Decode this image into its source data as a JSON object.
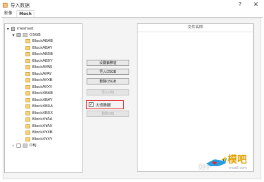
{
  "window": {
    "title": "导入数据",
    "help": "?",
    "close": "×"
  },
  "tabs": [
    {
      "label": "影像"
    },
    {
      "label": "Mesh"
    }
  ],
  "tree": {
    "root": {
      "label": "meshset",
      "expander": "▾"
    },
    "osgb": {
      "label": "OSGB",
      "expander": "▾"
    },
    "blocks": [
      "BlockABAB",
      "BlockABAY",
      "BlockABXB",
      "BlockABXY",
      "BlockAYAB",
      "BlockAYAY",
      "BlockAYXB",
      "BlockAYXY",
      "BlockXBAB",
      "BlockXBAY",
      "BlockXBXA",
      "BlockXBXX",
      "BlockXYAA",
      "BlockXYAX",
      "BlockXYXB",
      "BlockXYXY"
    ],
    "obj": {
      "label": "OBJ",
      "expander": "›"
    }
  },
  "buttons": {
    "set_offset": "设置偏移值",
    "import_osgb": "导入OSGB",
    "delete_osgb": "删除OSGB",
    "import_obj": "导入OBJ",
    "delete_obj": "删除OBJ"
  },
  "large_data": {
    "label": "大规数据",
    "checked": true,
    "mark": "✓"
  },
  "file_list": {
    "header": "文件名称"
  },
  "watermark": {
    "text": "知乎",
    "logo": "模吧",
    "domain": "moz8.com"
  }
}
